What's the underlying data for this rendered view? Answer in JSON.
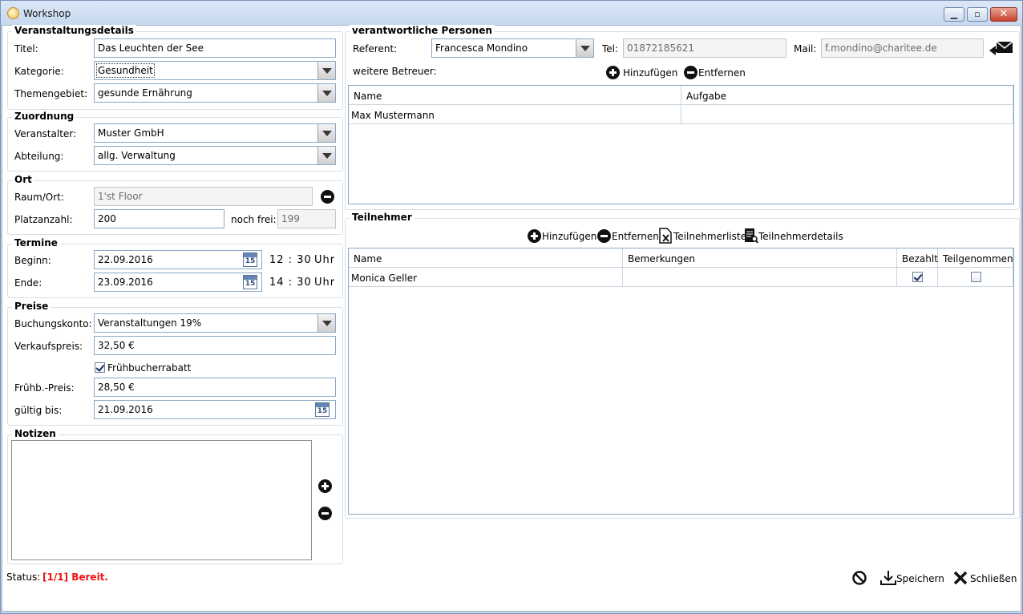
{
  "window": {
    "title": "Workshop"
  },
  "details": {
    "group_title": "Veranstaltungsdetails",
    "titel_label": "Titel:",
    "titel_value": "Das Leuchten der See",
    "kategorie_label": "Kategorie:",
    "kategorie_value": "Gesundheit",
    "themengebiet_label": "Themengebiet:",
    "themengebiet_value": "gesunde Ernährung"
  },
  "zuordnung": {
    "group_title": "Zuordnung",
    "veranstalter_label": "Veranstalter:",
    "veranstalter_value": "Muster GmbH",
    "abteilung_label": "Abteilung:",
    "abteilung_value": "allg. Verwaltung"
  },
  "ort": {
    "group_title": "Ort",
    "raum_label": "Raum/Ort:",
    "raum_value": "1'st Floor",
    "platz_label": "Platzanzahl:",
    "platz_value": "200",
    "frei_label": "noch frei:",
    "frei_value": "199"
  },
  "termine": {
    "group_title": "Termine",
    "beginn_label": "Beginn:",
    "beginn_date": "22.09.2016",
    "beginn_time": "12 : 30",
    "ende_label": "Ende:",
    "ende_date": "23.09.2016",
    "ende_time": "14 : 30",
    "uhr": "Uhr",
    "cal_day": "15"
  },
  "preise": {
    "group_title": "Preise",
    "konto_label": "Buchungskonto:",
    "konto_value": "Veranstaltungen 19%",
    "vk_label": "Verkaufspreis:",
    "vk_value": "32,50 €",
    "rabatt_label": "Frühbucherrabatt",
    "rabatt_checked": true,
    "fp_label": "Frühb.-Preis:",
    "fp_value": "28,50 €",
    "gueltig_label": "gültig bis:",
    "gueltig_value": "21.09.2016"
  },
  "notizen": {
    "group_title": "Notizen",
    "text": ""
  },
  "personen": {
    "group_title": "verantwortliche Personen",
    "referent_label": "Referent:",
    "referent_value": "Francesca Mondino",
    "tel_label": "Tel:",
    "tel_value": "01872185621",
    "mail_label": "Mail:",
    "mail_value": "f.mondino@charitee.de",
    "betreuer_label": "weitere Betreuer:",
    "add_label": "Hinzufügen",
    "remove_label": "Entfernen",
    "columns": [
      "Name",
      "Aufgabe"
    ],
    "rows": [
      [
        "Max Mustermann",
        ""
      ]
    ]
  },
  "teilnehmer": {
    "group_title": "Teilnehmer",
    "add_label": "Hinzufügen",
    "remove_label": "Entfernen",
    "list_label": "Teilnehmerliste",
    "details_label": "Teilnehmerdetails",
    "columns": [
      "Name",
      "Bemerkungen",
      "Bezahlt",
      "Teilgenommen"
    ],
    "rows": [
      {
        "name": "Monica Geller",
        "bemerkung": "",
        "bezahlt": true,
        "teilgenommen": false
      }
    ]
  },
  "footer": {
    "save_label": "Speichern",
    "close_label": "Schließen",
    "status_label": "Status:",
    "status_value": "[1/1] Bereit."
  }
}
